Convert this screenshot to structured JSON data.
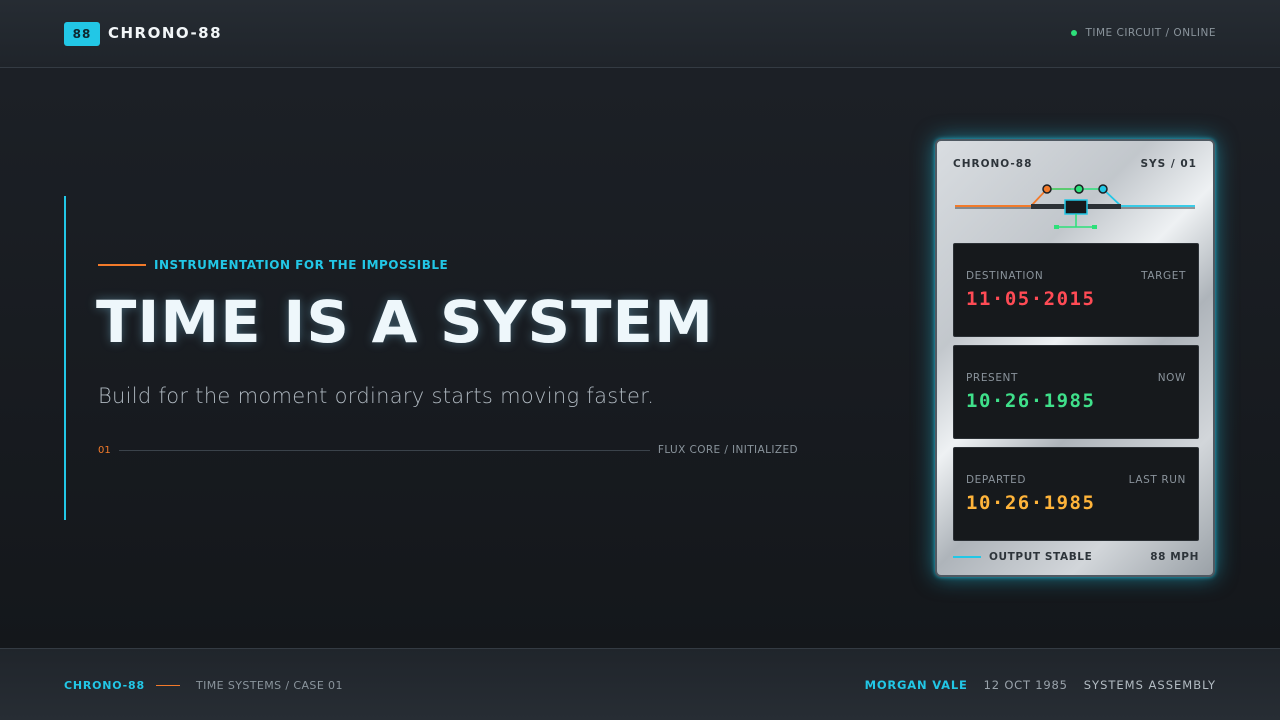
{
  "header": {
    "logo_badge": "88",
    "brand": "CHRONO-88",
    "status": "TIME CIRCUIT / ONLINE"
  },
  "hero": {
    "eyebrow": "INSTRUMENTATION FOR THE IMPOSSIBLE",
    "headline": "TIME IS A SYSTEM",
    "subline": "Build for the moment ordinary starts moving faster.",
    "rule_number": "01",
    "rule_label": "FLUX CORE / INITIALIZED"
  },
  "device": {
    "brand": "CHRONO-88",
    "sys": "SYS / 01",
    "panels": [
      {
        "label": "DESTINATION",
        "tag": "TARGET",
        "value": "11·05·2015",
        "color": "#ff4b55"
      },
      {
        "label": "PRESENT",
        "tag": "NOW",
        "value": "10·26·1985",
        "color": "#3fe08a"
      },
      {
        "label": "DEPARTED",
        "tag": "LAST RUN",
        "value": "10·26·1985",
        "color": "#ffb43a"
      }
    ],
    "footer_status": "OUTPUT STABLE",
    "footer_speed": "88 MPH"
  },
  "footer": {
    "brand": "CHRONO-88",
    "case": "TIME SYSTEMS / CASE 01",
    "name": "MORGAN VALE",
    "date": "12 OCT 1985",
    "team": "SYSTEMS ASSEMBLY"
  },
  "colors": {
    "accent": "#22c7e6",
    "orange": "#f27a2a",
    "status_online": "#2de07a"
  }
}
